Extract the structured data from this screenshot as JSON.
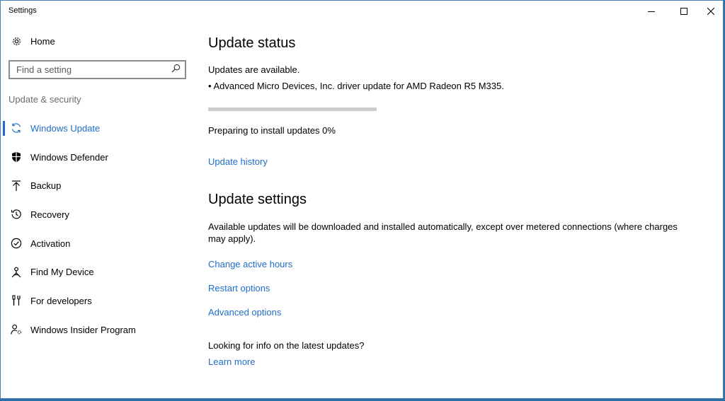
{
  "window": {
    "title": "Settings"
  },
  "sidebar": {
    "home_label": "Home",
    "search_placeholder": "Find a setting",
    "section_label": "Update & security",
    "items": [
      {
        "label": "Windows Update",
        "icon": "sync-icon",
        "active": true
      },
      {
        "label": "Windows Defender",
        "icon": "shield-icon",
        "active": false
      },
      {
        "label": "Backup",
        "icon": "upload-arrow-icon",
        "active": false
      },
      {
        "label": "Recovery",
        "icon": "history-icon",
        "active": false
      },
      {
        "label": "Activation",
        "icon": "checkmark-circle-icon",
        "active": false
      },
      {
        "label": "Find My Device",
        "icon": "person-location-icon",
        "active": false
      },
      {
        "label": "For developers",
        "icon": "developer-tools-icon",
        "active": false
      },
      {
        "label": "Windows Insider Program",
        "icon": "person-gear-icon",
        "active": false
      }
    ]
  },
  "main": {
    "update_status": {
      "heading": "Update status",
      "available_text": "Updates are available.",
      "update_item": "• Advanced Micro Devices, Inc. driver update for AMD Radeon R5 M335.",
      "progress_percent": 0,
      "progress_text": "Preparing to install updates 0%",
      "history_link": "Update history"
    },
    "update_settings": {
      "heading": "Update settings",
      "description": "Available updates will be downloaded and installed automatically, except over metered connections (where charges may apply).",
      "links": {
        "active_hours": "Change active hours",
        "restart_options": "Restart options",
        "advanced_options": "Advanced options"
      },
      "info_text": "Looking for info on the latest updates?",
      "learn_more": "Learn more"
    }
  },
  "colors": {
    "accent": "#1e6dc9",
    "progress_track": "#cccccc"
  }
}
